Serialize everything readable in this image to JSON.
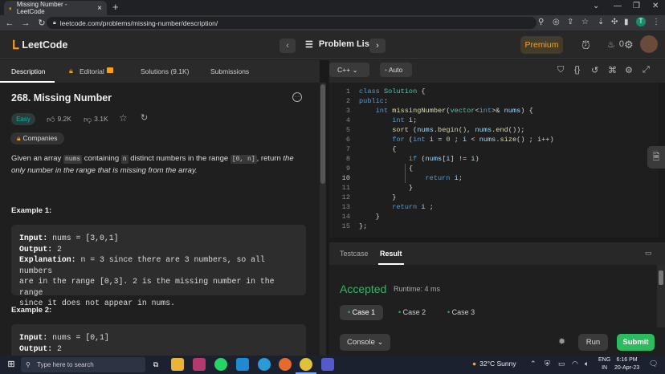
{
  "browser": {
    "tab_title": "Missing Number - LeetCode",
    "url": "leetcode.com/problems/missing-number/description/",
    "profile_initial": "T"
  },
  "header": {
    "logo_text": "LeetCode",
    "problem_list_label": "Problem List",
    "premium_label": "Premium",
    "coins": "0"
  },
  "left_tabs": [
    "Description",
    "Editorial",
    "Solutions (9.1K)",
    "Submissions"
  ],
  "problem": {
    "title": "268. Missing Number",
    "difficulty": "Easy",
    "likes": "9.2K",
    "dislikes": "3.1K",
    "companies_label": "Companies",
    "desc_1": "Given an array ",
    "desc_nums": "nums",
    "desc_2": " containing ",
    "desc_n": "n",
    "desc_3": " distinct numbers in the range ",
    "desc_range": "[0, n]",
    "desc_4": ", return ",
    "desc_5": "the only number in the range that is missing from the array.",
    "example1_heading": "Example 1:",
    "example1": {
      "input_label": "Input:",
      "input_value": " nums = [3,0,1]",
      "output_label": "Output:",
      "output_value": " 2",
      "explanation_label": "Explanation:",
      "explanation_l1": " n = 3 since there are 3 numbers, so all numbers",
      "explanation_l2": "are in the range [0,3]. 2 is the missing number in the range",
      "explanation_l3": "since it does not appear in nums."
    },
    "example2_heading": "Example 2:",
    "example2": {
      "input_label": "Input:",
      "input_value": " nums = [0,1]",
      "output_label": "Output:",
      "output_value": " 2"
    }
  },
  "editor": {
    "language": "C++",
    "mode": "Auto",
    "line_numbers": [
      "1",
      "2",
      "3",
      "4",
      "5",
      "6",
      "7",
      "8",
      "9",
      "10",
      "11",
      "12",
      "13",
      "14",
      "15"
    ]
  },
  "result": {
    "tabs": [
      "Testcase",
      "Result"
    ],
    "status": "Accepted",
    "runtime": "Runtime: 4 ms",
    "cases": [
      "Case 1",
      "Case 2",
      "Case 3"
    ],
    "console_label": "Console",
    "run_label": "Run",
    "submit_label": "Submit"
  },
  "taskbar": {
    "search_placeholder": "Type here to search",
    "weather": "32°C  Sunny",
    "lang_1": "ENG",
    "lang_2": "IN",
    "time": "6:16 PM",
    "date": "20-Apr-23"
  },
  "colors": {
    "accent": "#ffa116",
    "accepted": "#2cbb5d",
    "easy": "#00b8a3"
  }
}
